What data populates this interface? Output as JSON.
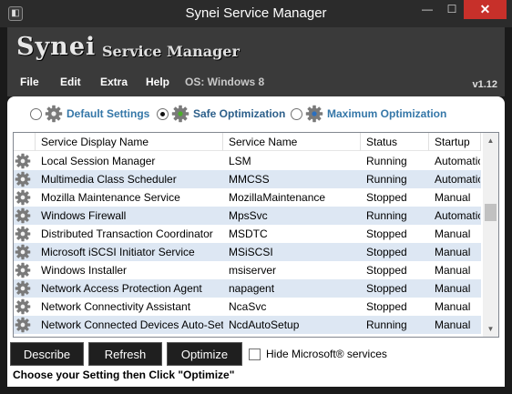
{
  "window": {
    "title": "Synei Service Manager",
    "controls": {
      "minimize": "—",
      "maximize": "☐",
      "close": "✕"
    }
  },
  "banner": {
    "brand": "Synei",
    "product": "Service Manager"
  },
  "menu": {
    "items": [
      "File",
      "Edit",
      "Extra",
      "Help"
    ],
    "os": "OS: Windows 8",
    "version": "v1.12"
  },
  "options": [
    {
      "label": "Default Settings",
      "selected": false,
      "icon": "gear-icon"
    },
    {
      "label": "Safe Optimization",
      "selected": true,
      "icon": "gear-icon"
    },
    {
      "label": "Maximum Optimization",
      "selected": false,
      "icon": "gear-icon"
    }
  ],
  "table": {
    "columns": [
      "Service Display Name",
      "Service Name",
      "Status",
      "Startup"
    ],
    "rows": [
      [
        "Local Session Manager",
        "LSM",
        "Running",
        "Automatic"
      ],
      [
        "Multimedia Class Scheduler",
        "MMCSS",
        "Running",
        "Automatic"
      ],
      [
        "Mozilla Maintenance Service",
        "MozillaMaintenance",
        "Stopped",
        "Manual"
      ],
      [
        "Windows Firewall",
        "MpsSvc",
        "Running",
        "Automatic"
      ],
      [
        "Distributed Transaction Coordinator",
        "MSDTC",
        "Stopped",
        "Manual"
      ],
      [
        "Microsoft iSCSI Initiator Service",
        "MSiSCSI",
        "Stopped",
        "Manual"
      ],
      [
        "Windows Installer",
        "msiserver",
        "Stopped",
        "Manual"
      ],
      [
        "Network Access Protection Agent",
        "napagent",
        "Stopped",
        "Manual"
      ],
      [
        "Network Connectivity Assistant",
        "NcaSvc",
        "Stopped",
        "Manual"
      ],
      [
        "Network Connected Devices Auto-Setup",
        "NcdAutoSetup",
        "Running",
        "Manual"
      ]
    ]
  },
  "buttons": {
    "describe": "Describe",
    "refresh": "Refresh",
    "optimize": "Optimize"
  },
  "hide_microsoft": {
    "label": "Hide Microsoft® services",
    "checked": false
  },
  "status": "Choose your Setting then Click \"Optimize\"",
  "colors": {
    "accent": "#3577a8",
    "row_alt": "#dde7f3",
    "close": "#c7302a",
    "chrome": "#3a3a3a"
  }
}
